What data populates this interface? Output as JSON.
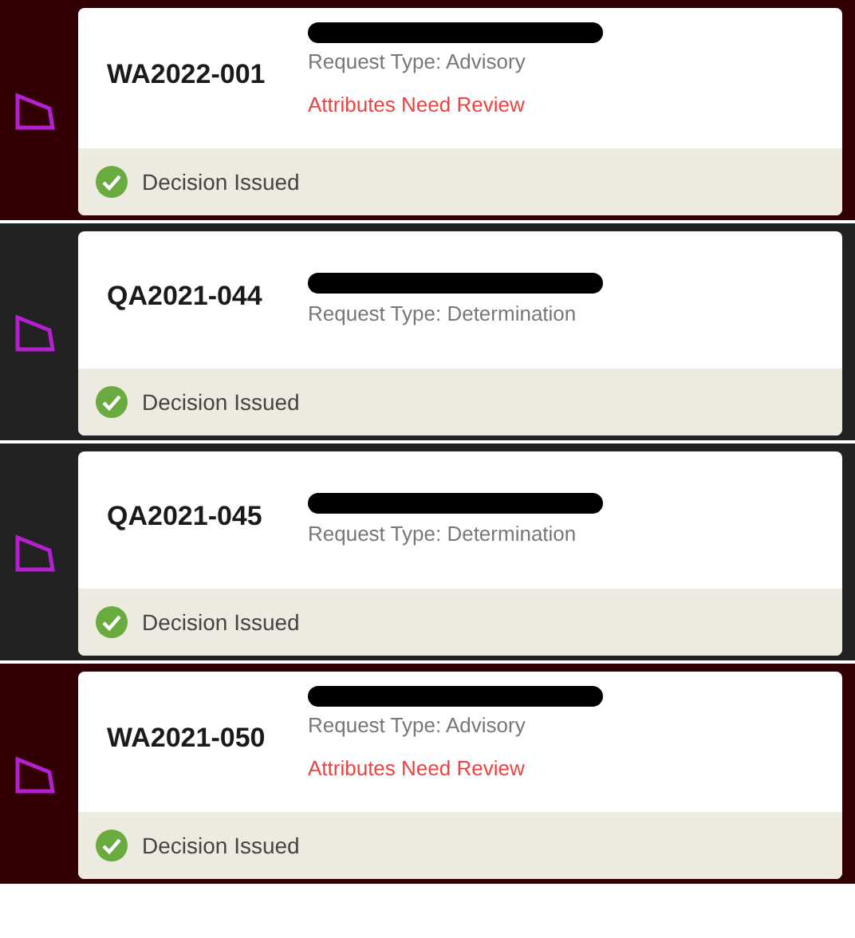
{
  "requests": [
    {
      "id": "WA2022-001",
      "highlighted": true,
      "address_redacted": true,
      "request_type": "Request Type: Advisory",
      "review_note": "Attributes Need Review",
      "status": "Decision Issued",
      "status_done": true
    },
    {
      "id": "QA2021-044",
      "highlighted": false,
      "address_redacted": true,
      "request_type": "Request Type: Determination",
      "status": "Decision Issued",
      "status_done": true
    },
    {
      "id": "QA2021-045",
      "highlighted": false,
      "address_redacted": true,
      "request_type": "Request Type: Determination",
      "status": "Decision Issued",
      "status_done": true
    },
    {
      "id": "WA2021-050",
      "highlighted": true,
      "address_redacted": true,
      "request_type": "Request Type: Advisory",
      "review_note": "Attributes Need Review",
      "status": "Decision Issued",
      "status_done": true
    }
  ]
}
